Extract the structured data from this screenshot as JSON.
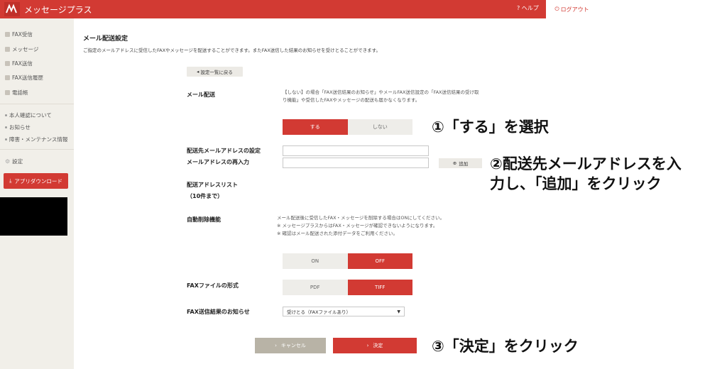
{
  "header": {
    "title": "メッセージプラス",
    "help_label": "ヘルプ",
    "logout_label": "ログアウト",
    "brand_color": "#d23a33"
  },
  "sidebar": {
    "items": [
      {
        "label": "FAX受信",
        "icon": "fax-inbox-icon"
      },
      {
        "label": "メッセージ",
        "icon": "message-icon"
      },
      {
        "label": "FAX送信",
        "icon": "fax-send-icon"
      },
      {
        "label": "FAX送信履歴",
        "icon": "history-icon"
      },
      {
        "label": "電話帳",
        "icon": "phonebook-icon"
      }
    ],
    "links": [
      {
        "label": "本人確認について"
      },
      {
        "label": "お知らせ"
      },
      {
        "label": "障害・メンテナンス情報"
      }
    ],
    "settings_label": "設定",
    "app_download_label": "アプリダウンロード"
  },
  "main": {
    "title": "メール配送設定",
    "description": "ご指定のメールアドレスに受信したFAXやメッセージを配送することができます。またFAX送信した結果のお知らせを受けとることができます。",
    "back_label": "設定一覧に戻る",
    "mail_delivery": {
      "label": "メール配送",
      "note_line1": "【しない】の場合「FAX送信結果のお知らせ」やメールFAX送信設定の「FAX送信結果の受け取",
      "note_line2": "り機能」や受信したFAXやメッセージの配送も届かなくなります。",
      "on_label": "する",
      "off_label": "しない",
      "selected": "する"
    },
    "address_setting_label": "配送先メールアドレスの設定",
    "address_confirm_label": "メールアドレスの再入力",
    "address_value": "",
    "address_confirm_value": "",
    "add_label": "追加",
    "list_label": "配送アドレスリスト",
    "list_limit_label": "（10件まで）",
    "auto_delete": {
      "label": "自動削除機能",
      "note1": "メール配送後に受信したFAX・メッセージを削除する場合はONにしてください。",
      "note2": "※ メッセージプラスからはFAX・メッセージが確認できないようになります。",
      "note3": "※ 確認はメール配送された添付データをご利用ください。",
      "on_label": "ON",
      "off_label": "OFF",
      "selected": "OFF"
    },
    "fax_format": {
      "label": "FAXファイルの形式",
      "pdf_label": "PDF",
      "tiff_label": "TIFF",
      "selected": "TIFF"
    },
    "fax_result": {
      "label": "FAX送信結果のお知らせ",
      "selected_value": "受けとる（FAXファイルあり）"
    },
    "cancel_label": "キャンセル",
    "submit_label": "決定"
  },
  "annotations": {
    "step1": "①「する」を選択",
    "step2_line1": "②配送先メールアドレスを入",
    "step2_line2": "力し、「追加」をクリック",
    "step3": "③「決定」をクリック"
  }
}
